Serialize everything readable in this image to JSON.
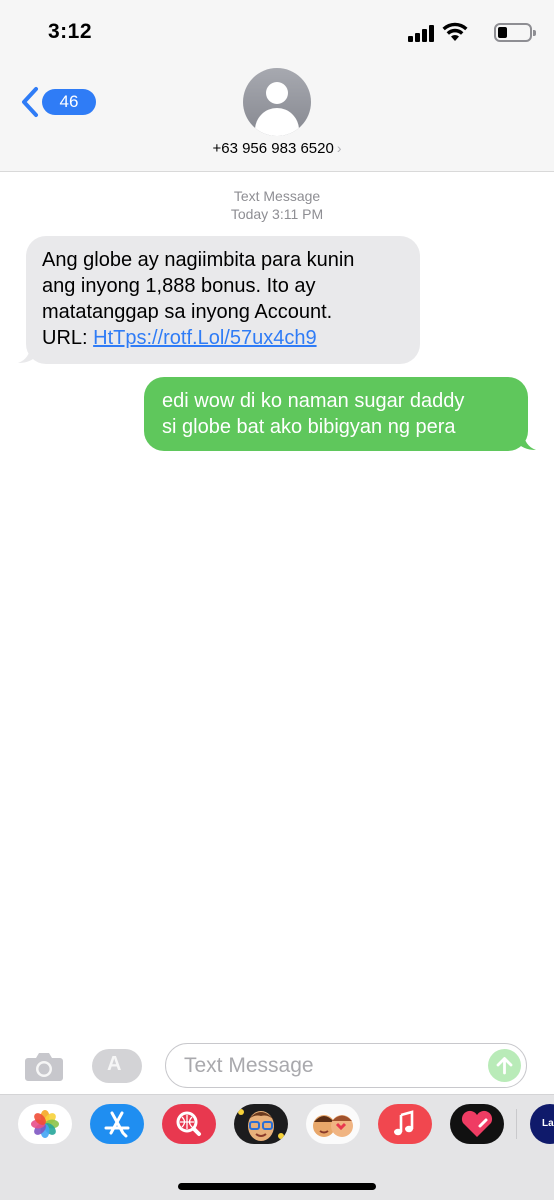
{
  "status_bar": {
    "time": "3:12"
  },
  "header": {
    "back_badge": "46",
    "contact": "+63 956 983 6520",
    "contact_chevron": "›"
  },
  "conversation": {
    "service": "Text Message",
    "timestamp": "Today 3:11 PM",
    "messages": [
      {
        "direction": "incoming",
        "lines": [
          "Ang globe ay nagiimbita para kunin",
          "ang inyong 1,888 bonus. Ito ay",
          "matatanggap sa inyong Account."
        ],
        "url_prefix": "URL: ",
        "url": "HtTps://rotf.Lol/57ux4ch9"
      },
      {
        "direction": "outgoing",
        "lines": [
          "edi wow di ko naman sugar daddy",
          "si globe bat ako bibigyan ng pera"
        ]
      }
    ]
  },
  "composer": {
    "placeholder": "Text Message",
    "apps_glyph": "A"
  },
  "app_drawer": {
    "apps": [
      {
        "icon": "photos-icon"
      },
      {
        "icon": "app-store-icon"
      },
      {
        "icon": "images-search-icon"
      },
      {
        "icon": "memoji-icon"
      },
      {
        "icon": "memoji-stickers-icon"
      },
      {
        "icon": "music-icon"
      },
      {
        "icon": "digital-touch-icon"
      },
      {
        "icon": "lazada-icon",
        "label": "Laz"
      }
    ]
  },
  "colors": {
    "accent": "#2f7cf6",
    "incoming_bubble": "#e9e9eb",
    "outgoing_bubble": "#5fc75c",
    "header_bg": "#f6f6f6"
  }
}
